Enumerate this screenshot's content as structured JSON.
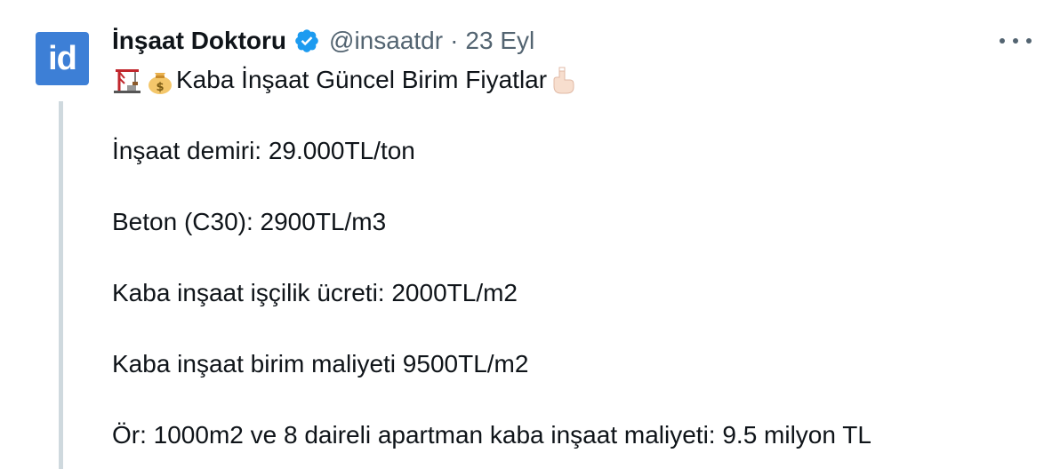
{
  "author": {
    "name": "İnşaat Doktoru",
    "handle": "@insaatdr",
    "separator": "·",
    "date": "23 Eyl",
    "avatar_text": "id",
    "verified": true
  },
  "icons": {
    "verified": "verified-badge-icon",
    "more": "more-horizontal-icon",
    "crane": "crane-emoji-icon",
    "money_bag": "money-bag-emoji-icon",
    "pointing_down": "backhand-index-pointing-down-emoji-icon"
  },
  "colors": {
    "verified_blue": "#1d9bf0",
    "avatar_blue": "#3d7fd6",
    "secondary_text": "#536471",
    "thread_line": "#cfd9de"
  },
  "tweet": {
    "title": "Kaba İnşaat Güncel Birim Fiyatlar",
    "lines": [
      "İnşaat demiri: 29.000TL/ton",
      "Beton (C30): 2900TL/m3",
      "Kaba inşaat işçilik ücreti: 2000TL/m2",
      "Kaba inşaat birim maliyeti 9500TL/m2",
      "Ör: 1000m2 ve 8 daireli apartman kaba inşaat maliyeti: 9.5 milyon TL"
    ]
  }
}
